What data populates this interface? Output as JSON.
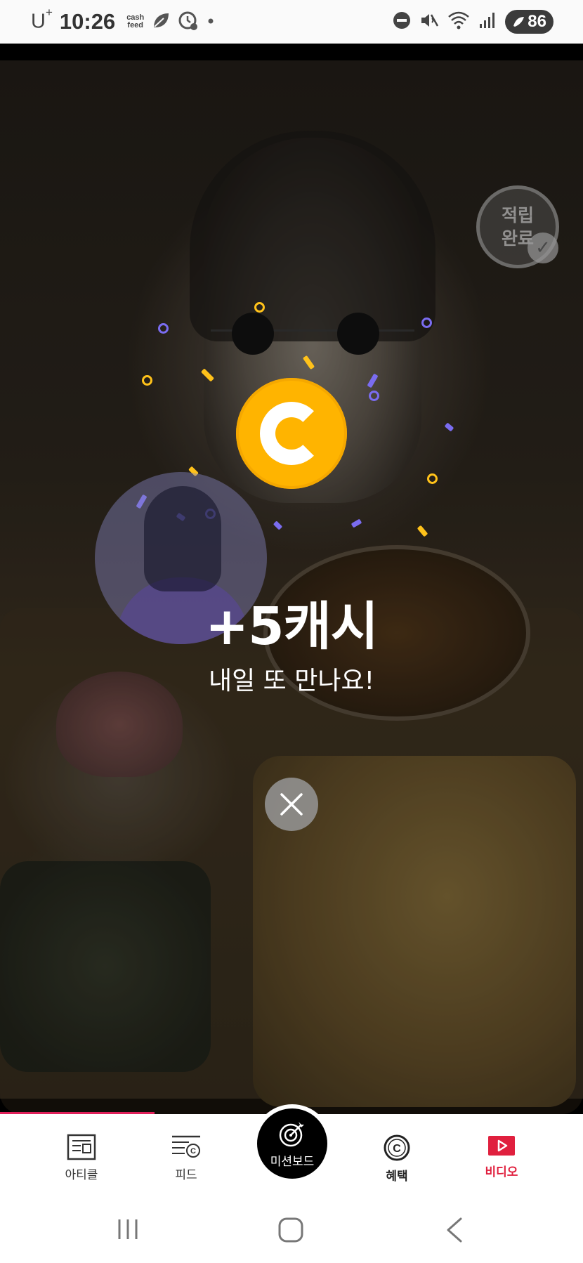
{
  "status_bar": {
    "carrier": "U",
    "carrier_sup": "+",
    "time": "10:26",
    "app_badge_line1": "cash",
    "app_badge_line2": "feed",
    "battery": "86",
    "icons": [
      "leaf-icon",
      "timer-icon",
      "dot-icon",
      "dnd-icon",
      "mute-icon",
      "wifi-icon",
      "signal-icon",
      "battery-icon"
    ]
  },
  "saved_badge": {
    "line1": "적립",
    "line2": "완료"
  },
  "reward": {
    "title": "+5캐시",
    "subtitle": "내일 또 만나요!"
  },
  "bottom_nav": {
    "items": [
      {
        "label": "아티클",
        "icon": "article-icon"
      },
      {
        "label": "피드",
        "icon": "feed-icon"
      },
      {
        "label": "미션보드",
        "icon": "target-icon"
      },
      {
        "label": "혜택",
        "icon": "coin-icon"
      },
      {
        "label": "비디오",
        "icon": "play-icon"
      }
    ]
  },
  "colors": {
    "accent": "#e0203e",
    "coin": "#ffb400",
    "confetti_purple": "#7a6cf0",
    "confetti_yellow": "#ffc21a"
  }
}
